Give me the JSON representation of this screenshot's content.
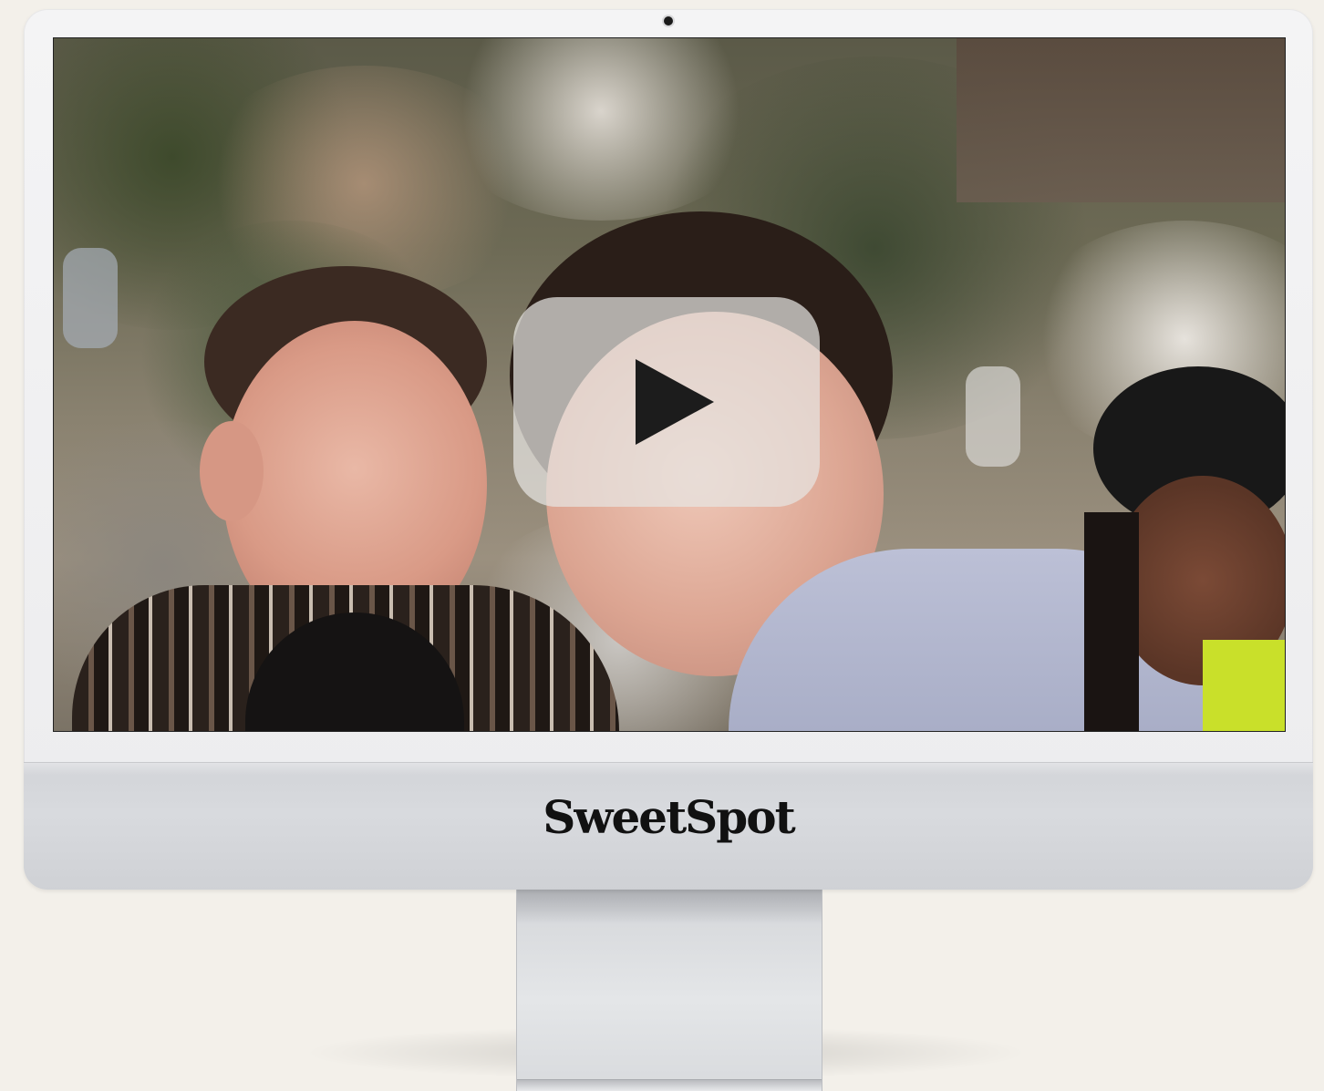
{
  "brand": {
    "name": "SweetSpot"
  },
  "video": {
    "play_icon": "play-triangle-icon",
    "thumbnail_description_icon": "video-thumbnail"
  },
  "colors": {
    "background": "#f3f0ea",
    "monitor_silver": "#d8dade",
    "play_button_overlay": "#e6e4e2",
    "play_icon": "#1c1c1c",
    "brand_text": "#111111"
  }
}
